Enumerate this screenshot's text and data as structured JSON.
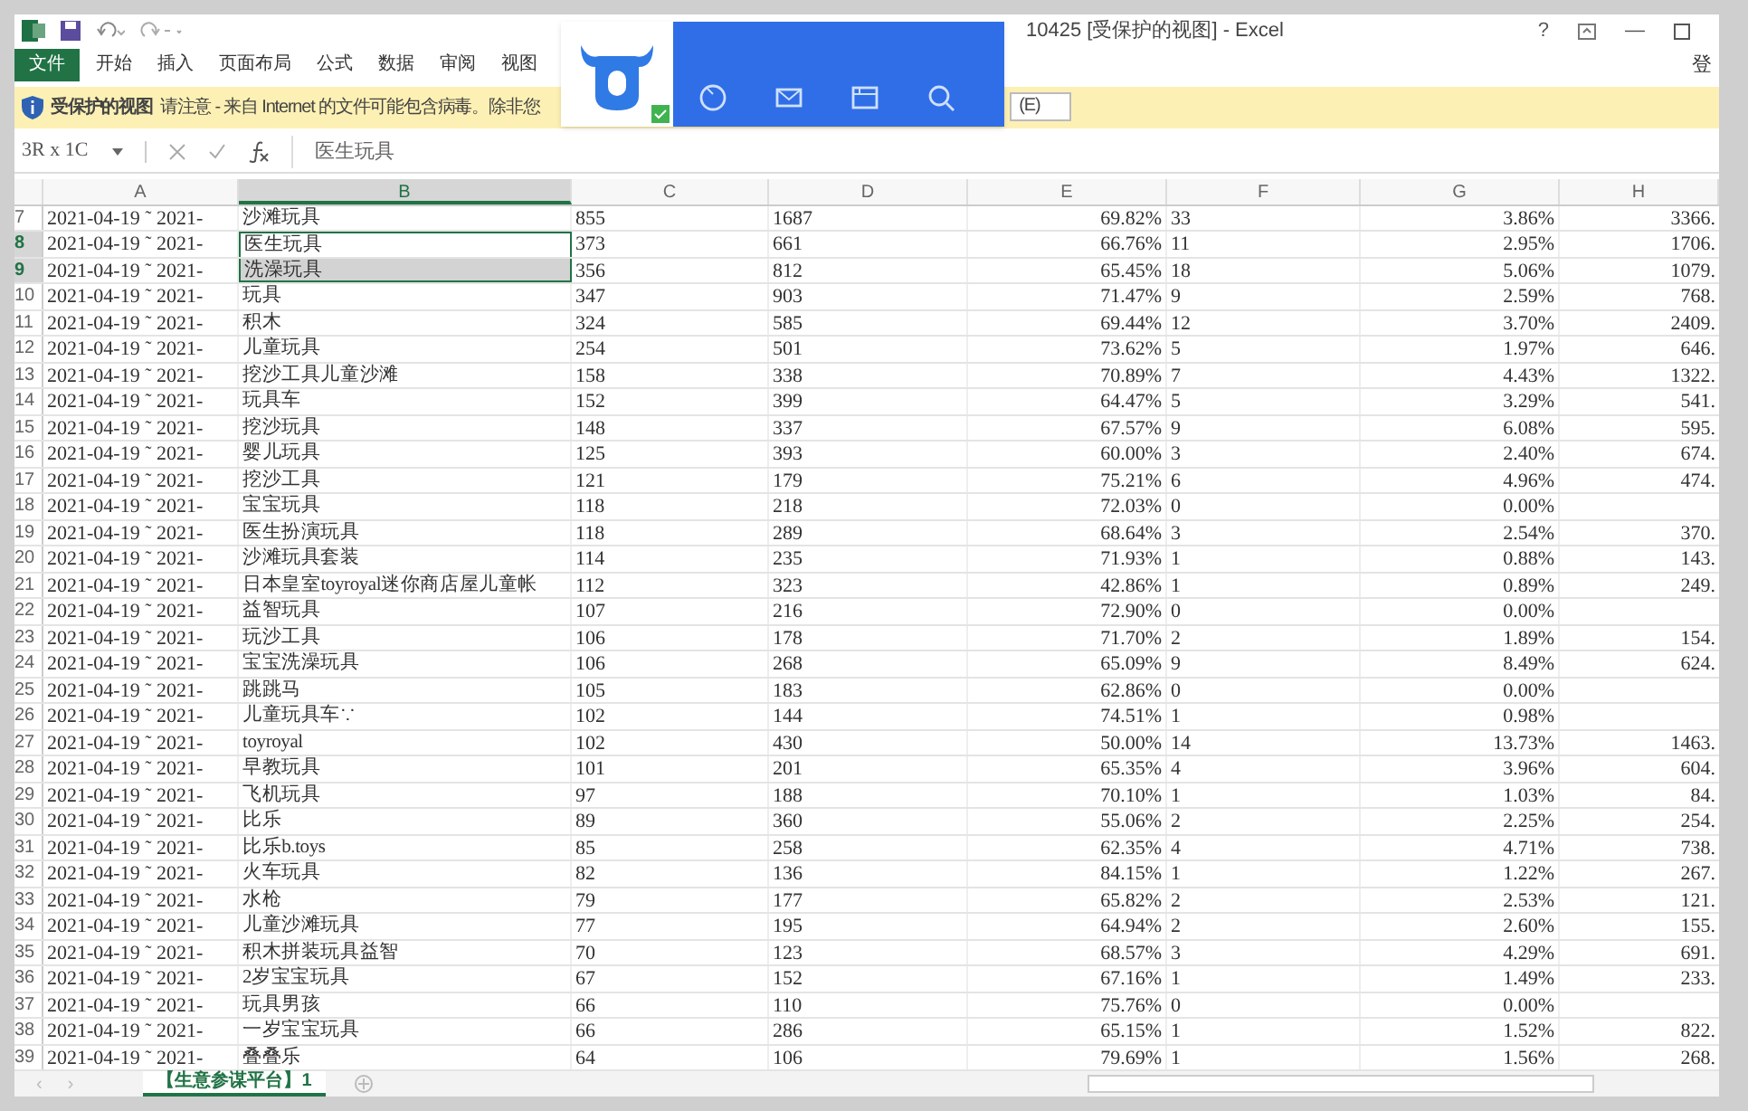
{
  "window": {
    "title": "10425 [受保护的视图] - Excel",
    "controls": [
      "?",
      "—"
    ],
    "account": "登"
  },
  "ribbon_tabs": [
    {
      "label": "文件",
      "selected": true
    },
    {
      "label": "开始",
      "selected": false
    },
    {
      "label": "插入",
      "selected": false
    },
    {
      "label": "页面布局",
      "selected": false
    },
    {
      "label": "公式",
      "selected": false
    },
    {
      "label": "数据",
      "selected": false
    },
    {
      "label": "审阅",
      "selected": false
    },
    {
      "label": "视图",
      "selected": false
    }
  ],
  "protected_bar": {
    "title": "受保护的视图",
    "message": "请注意 - 来自 Internet 的文件可能包含病毒。除非您",
    "button": "(E)"
  },
  "formula_bar": {
    "name_box": "3R x 1C",
    "value": "医生玩具"
  },
  "columns": [
    "A",
    "B",
    "C",
    "D",
    "E",
    "F",
    "G",
    "H"
  ],
  "rows": [
    {
      "n": "7",
      "a": "2021-04-19 ˜ 2021-",
      "b": "沙滩玩具",
      "c": "855",
      "d": "1687",
      "e": "69.82%",
      "f": "33",
      "g": "3.86%",
      "h": "3366.",
      "selected": false
    },
    {
      "n": "8",
      "a": "2021-04-19 ˜ 2021-",
      "b": "医生玩具",
      "c": "373",
      "d": "661",
      "e": "66.76%",
      "f": "11",
      "g": "2.95%",
      "h": "1706.",
      "selected": true
    },
    {
      "n": "9",
      "a": "2021-04-19 ˜ 2021-",
      "b": "洗澡玩具",
      "c": "356",
      "d": "812",
      "e": "65.45%",
      "f": "18",
      "g": "5.06%",
      "h": "1079.",
      "selected": true
    },
    {
      "n": "10",
      "a": "2021-04-19 ˜ 2021-",
      "b": "玩具",
      "c": "347",
      "d": "903",
      "e": "71.47%",
      "f": "9",
      "g": "2.59%",
      "h": "768.",
      "selected": false
    },
    {
      "n": "11",
      "a": "2021-04-19 ˜ 2021-",
      "b": "积木",
      "c": "324",
      "d": "585",
      "e": "69.44%",
      "f": "12",
      "g": "3.70%",
      "h": "2409.",
      "selected": false
    },
    {
      "n": "12",
      "a": "2021-04-19 ˜ 2021-",
      "b": "儿童玩具",
      "c": "254",
      "d": "501",
      "e": "73.62%",
      "f": "5",
      "g": "1.97%",
      "h": "646.",
      "selected": false
    },
    {
      "n": "13",
      "a": "2021-04-19 ˜ 2021-",
      "b": "挖沙工具儿童沙滩",
      "c": "158",
      "d": "338",
      "e": "70.89%",
      "f": "7",
      "g": "4.43%",
      "h": "1322.",
      "selected": false
    },
    {
      "n": "14",
      "a": "2021-04-19 ˜ 2021-",
      "b": "玩具车",
      "c": "152",
      "d": "399",
      "e": "64.47%",
      "f": "5",
      "g": "3.29%",
      "h": "541.",
      "selected": false
    },
    {
      "n": "15",
      "a": "2021-04-19 ˜ 2021-",
      "b": "挖沙玩具",
      "c": "148",
      "d": "337",
      "e": "67.57%",
      "f": "9",
      "g": "6.08%",
      "h": "595.",
      "selected": false
    },
    {
      "n": "16",
      "a": "2021-04-19 ˜ 2021-",
      "b": "婴儿玩具",
      "c": "125",
      "d": "393",
      "e": "60.00%",
      "f": "3",
      "g": "2.40%",
      "h": "674.",
      "selected": false
    },
    {
      "n": "17",
      "a": "2021-04-19 ˜ 2021-",
      "b": "挖沙工具",
      "c": "121",
      "d": "179",
      "e": "75.21%",
      "f": "6",
      "g": "4.96%",
      "h": "474.",
      "selected": false
    },
    {
      "n": "18",
      "a": "2021-04-19 ˜ 2021-",
      "b": "宝宝玩具",
      "c": "118",
      "d": "218",
      "e": "72.03%",
      "f": "0",
      "g": "0.00%",
      "selected": false
    },
    {
      "n": "19",
      "a": "2021-04-19 ˜ 2021-",
      "b": "医生扮演玩具",
      "c": "118",
      "d": "289",
      "e": "68.64%",
      "f": "3",
      "g": "2.54%",
      "h": "370.",
      "selected": false
    },
    {
      "n": "20",
      "a": "2021-04-19 ˜ 2021-",
      "b": "沙滩玩具套装",
      "c": "114",
      "d": "235",
      "e": "71.93%",
      "f": "1",
      "g": "0.88%",
      "h": "143.",
      "selected": false
    },
    {
      "n": "21",
      "a": "2021-04-19 ˜ 2021-",
      "b": "日本皇室toyroyal迷你商店屋儿童帐",
      "c": "112",
      "d": "323",
      "e": "42.86%",
      "f": "1",
      "g": "0.89%",
      "h": "249.",
      "selected": false
    },
    {
      "n": "22",
      "a": "2021-04-19 ˜ 2021-",
      "b": "益智玩具",
      "c": "107",
      "d": "216",
      "e": "72.90%",
      "f": "0",
      "g": "0.00%",
      "selected": false
    },
    {
      "n": "23",
      "a": "2021-04-19 ˜ 2021-",
      "b": "玩沙工具",
      "c": "106",
      "d": "178",
      "e": "71.70%",
      "f": "2",
      "g": "1.89%",
      "h": "154.",
      "selected": false
    },
    {
      "n": "24",
      "a": "2021-04-19 ˜ 2021-",
      "b": "宝宝洗澡玩具",
      "c": "106",
      "d": "268",
      "e": "65.09%",
      "f": "9",
      "g": "8.49%",
      "h": "624.",
      "selected": false
    },
    {
      "n": "25",
      "a": "2021-04-19 ˜ 2021-",
      "b": "跳跳马",
      "c": "105",
      "d": "183",
      "e": "62.86%",
      "f": "0",
      "g": "0.00%",
      "selected": false
    },
    {
      "n": "26",
      "a": "2021-04-19 ˜ 2021-",
      "b": "儿童玩具车∵",
      "c": "102",
      "d": "144",
      "e": "74.51%",
      "f": "1",
      "g": "0.98%",
      "selected": false
    },
    {
      "n": "27",
      "a": "2021-04-19 ˜ 2021-",
      "b": "toyroyal",
      "c": "102",
      "d": "430",
      "e": "50.00%",
      "f": "14",
      "g": "13.73%",
      "h": "1463.",
      "selected": false
    },
    {
      "n": "28",
      "a": "2021-04-19 ˜ 2021-",
      "b": "早教玩具",
      "c": "101",
      "d": "201",
      "e": "65.35%",
      "f": "4",
      "g": "3.96%",
      "h": "604.",
      "selected": false
    },
    {
      "n": "29",
      "a": "2021-04-19 ˜ 2021-",
      "b": "飞机玩具",
      "c": "97",
      "d": "188",
      "e": "70.10%",
      "f": "1",
      "g": "1.03%",
      "h": "84.",
      "selected": false
    },
    {
      "n": "30",
      "a": "2021-04-19 ˜ 2021-",
      "b": "比乐",
      "c": "89",
      "d": "360",
      "e": "55.06%",
      "f": "2",
      "g": "2.25%",
      "h": "254.",
      "selected": false
    },
    {
      "n": "31",
      "a": "2021-04-19 ˜ 2021-",
      "b": "比乐b.toys",
      "c": "85",
      "d": "258",
      "e": "62.35%",
      "f": "4",
      "g": "4.71%",
      "h": "738.",
      "selected": false
    },
    {
      "n": "32",
      "a": "2021-04-19 ˜ 2021-",
      "b": "火车玩具",
      "c": "82",
      "d": "136",
      "e": "84.15%",
      "f": "1",
      "g": "1.22%",
      "h": "267.",
      "selected": false
    },
    {
      "n": "33",
      "a": "2021-04-19 ˜ 2021-",
      "b": "水枪",
      "c": "79",
      "d": "177",
      "e": "65.82%",
      "f": "2",
      "g": "2.53%",
      "h": "121.",
      "selected": false
    },
    {
      "n": "34",
      "a": "2021-04-19 ˜ 2021-",
      "b": "儿童沙滩玩具",
      "c": "77",
      "d": "195",
      "e": "64.94%",
      "f": "2",
      "g": "2.60%",
      "h": "155.",
      "selected": false
    },
    {
      "n": "35",
      "a": "2021-04-19 ˜ 2021-",
      "b": "积木拼装玩具益智",
      "c": "70",
      "d": "123",
      "e": "68.57%",
      "f": "3",
      "g": "4.29%",
      "h": "691.",
      "selected": false
    },
    {
      "n": "36",
      "a": "2021-04-19 ˜ 2021-",
      "b": "2岁宝宝玩具",
      "c": "67",
      "d": "152",
      "e": "67.16%",
      "f": "1",
      "g": "1.49%",
      "h": "233.",
      "selected": false
    },
    {
      "n": "37",
      "a": "2021-04-19 ˜ 2021-",
      "b": "玩具男孩",
      "c": "66",
      "d": "110",
      "e": "75.76%",
      "f": "0",
      "g": "0.00%",
      "selected": false
    },
    {
      "n": "38",
      "a": "2021-04-19 ˜ 2021-",
      "b": "一岁宝宝玩具",
      "c": "66",
      "d": "286",
      "e": "65.15%",
      "f": "1",
      "g": "1.52%",
      "h": "822.",
      "selected": false
    },
    {
      "n": "39",
      "a": "2021-04-19 ˜ 2021-",
      "b": "叠叠乐",
      "c": "64",
      "d": "106",
      "e": "79.69%",
      "f": "1",
      "g": "1.56%",
      "h": "268.",
      "selected": false
    }
  ],
  "sheet_nav": [
    "‹",
    "›"
  ],
  "sheet_tabs": [
    {
      "label": "【生意参谋平台】1",
      "selected": true
    }
  ]
}
